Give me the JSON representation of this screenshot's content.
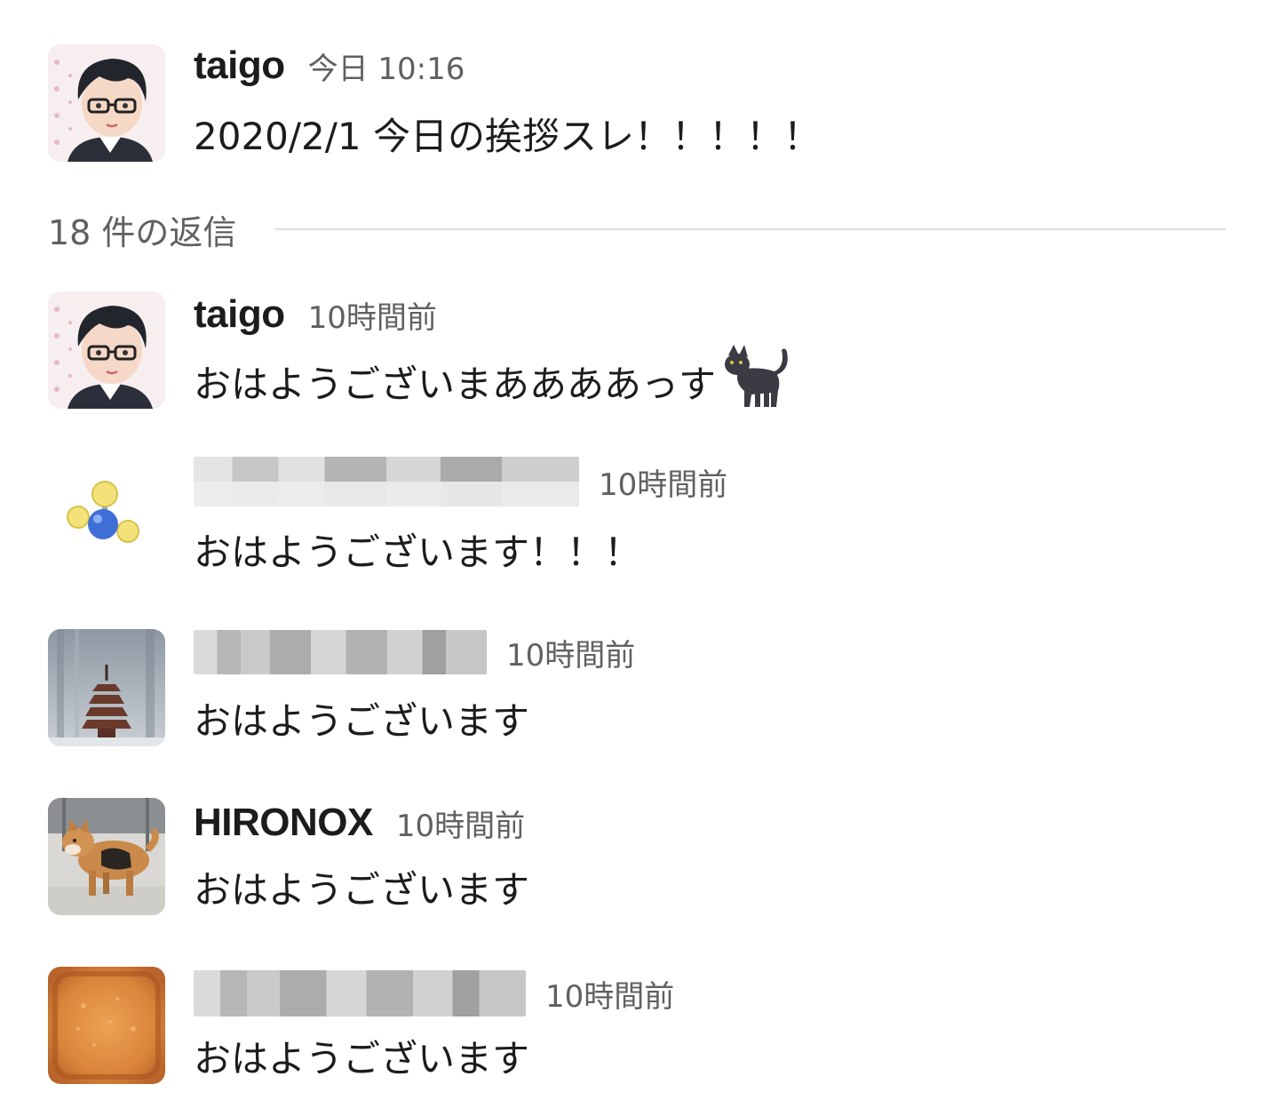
{
  "thread": {
    "parent": {
      "author": "taigo",
      "time": "今日 10:16",
      "text": "2020/2/1 今日の挨拶スレ！！！！！",
      "avatar_icon": "person-with-glasses-avatar"
    },
    "reply_count_label": "18 件の返信",
    "replies": [
      {
        "author": "taigo",
        "time": "10時間前",
        "text": "おはようございまああああっす",
        "emoji": "black-cat-emoji",
        "avatar_icon": "person-with-glasses-avatar"
      },
      {
        "author": "",
        "time": "10時間前",
        "text": "おはようございます！！！",
        "avatar_icon": "molecule-avatar"
      },
      {
        "author": "",
        "time": "10時間前",
        "text": "おはようございます",
        "avatar_icon": "pagoda-avatar"
      },
      {
        "author": "HIRONOX",
        "time": "10時間前",
        "text": "おはようございます",
        "avatar_icon": "shiba-dog-avatar"
      },
      {
        "author": "",
        "time": "10時間前",
        "text": "おはようございます",
        "avatar_icon": "toast-avatar"
      }
    ]
  },
  "colors": {
    "text": "#1d1c1d",
    "muted": "#616061",
    "divider": "#dddddd"
  }
}
